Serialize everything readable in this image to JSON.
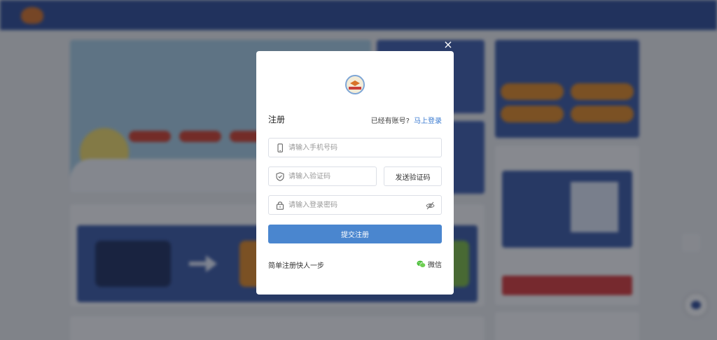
{
  "modal": {
    "title": "注册",
    "have_account_text": "已经有账号?",
    "login_link": "马上登录",
    "phone_placeholder": "请输入手机号码",
    "code_placeholder": "请输入验证码",
    "send_code_label": "发送验证码",
    "password_placeholder": "请输入登录密码",
    "submit_label": "提交注册",
    "tagline": "简单注册快人一步",
    "wechat_label": "微信",
    "close_symbol": "×"
  },
  "icons": {
    "close": "close-icon",
    "logo": "school-emblem-icon",
    "phone": "phone-icon",
    "code": "shield-icon",
    "password": "lock-icon",
    "visibility": "eye-off-icon",
    "wechat": "wechat-icon"
  },
  "colors": {
    "primary_button": "#4a86cf",
    "link": "#3b7bd1",
    "wechat_green": "#4cbf3a",
    "background_nav": "#2f4d99"
  }
}
